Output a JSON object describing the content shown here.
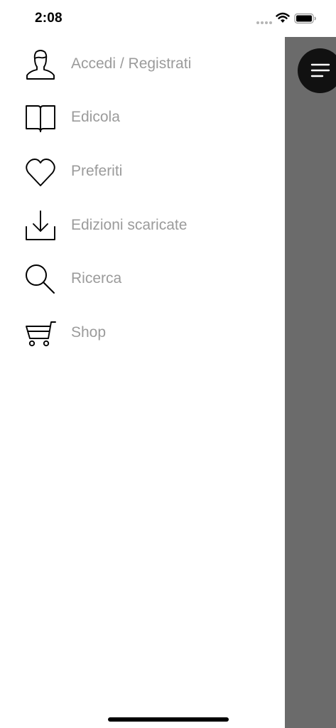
{
  "status_bar": {
    "time": "2:08",
    "icons": [
      "signal-dots-icon",
      "wifi-icon",
      "battery-icon"
    ]
  },
  "menu": {
    "items": [
      {
        "label": "Accedi / Registrati",
        "icon": "user-icon"
      },
      {
        "label": "Edicola",
        "icon": "open-book-icon"
      },
      {
        "label": "Preferiti",
        "icon": "heart-icon"
      },
      {
        "label": "Edizioni scaricate",
        "icon": "download-tray-icon"
      },
      {
        "label": "Ricerca",
        "icon": "search-icon"
      },
      {
        "label": "Shop",
        "icon": "shopping-cart-icon"
      }
    ]
  },
  "menu_button": {
    "icon": "menu-lines-icon"
  },
  "colors": {
    "label_text": "#9b9b9b",
    "icon_stroke": "#000000",
    "dim_overlay": "#6b6b6b",
    "menu_button_bg": "#111111"
  }
}
